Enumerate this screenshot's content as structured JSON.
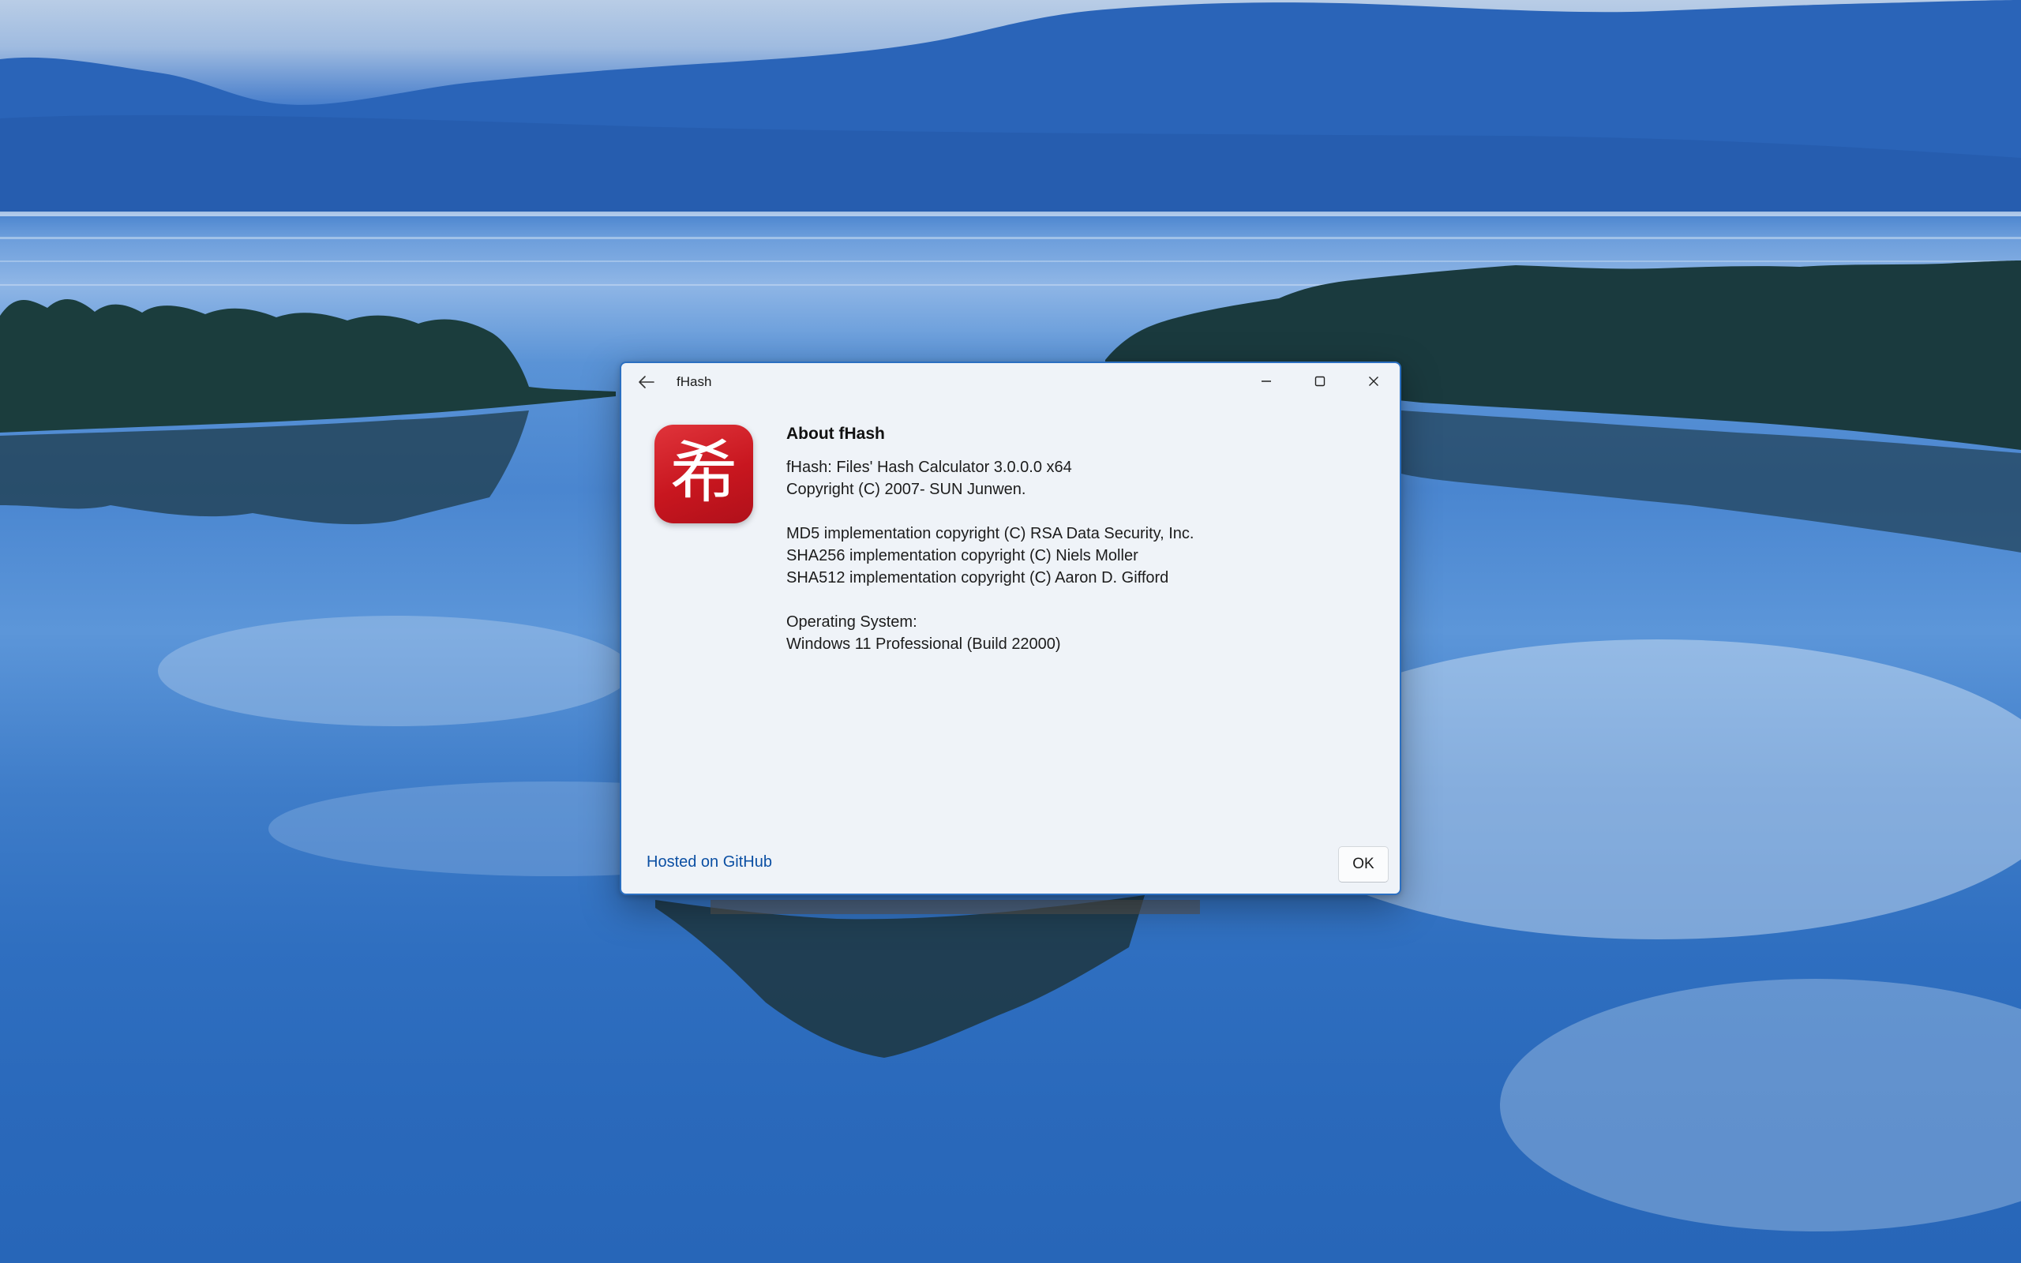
{
  "window": {
    "title": "fHash",
    "accent_color": "#2b6fc1",
    "back_icon": "back-arrow-icon",
    "caption_buttons": [
      "minimize-icon",
      "maximize-icon",
      "close-icon"
    ]
  },
  "about": {
    "app_icon_glyph": "希",
    "app_icon_color": "#c8161f",
    "heading": "About fHash",
    "lines": [
      "fHash: Files' Hash Calculator 3.0.0.0 x64",
      "Copyright (C) 2007- SUN Junwen.",
      "",
      "MD5 implementation copyright (C) RSA Data Security, Inc.",
      "SHA256 implementation copyright (C) Niels Moller",
      "SHA512 implementation copyright (C) Aaron D. Gifford",
      "",
      "Operating System:",
      "Windows 11 Professional (Build 22000)"
    ]
  },
  "footer": {
    "link_label": "Hosted on GitHub",
    "link_color": "#0b4fa3",
    "ok_label": "OK"
  }
}
